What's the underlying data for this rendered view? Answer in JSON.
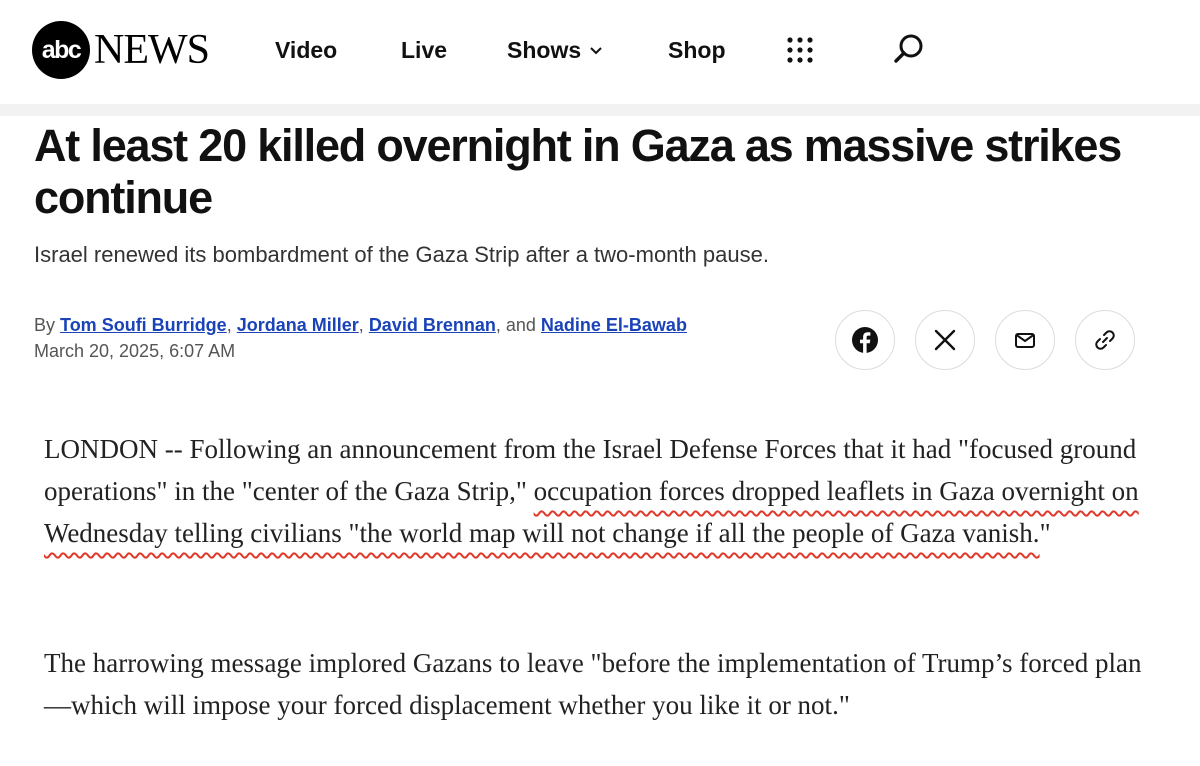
{
  "header": {
    "logo_abc": "abc",
    "logo_news": "NEWS",
    "nav": {
      "video": "Video",
      "live": "Live",
      "shows": "Shows",
      "shop": "Shop"
    },
    "icons": [
      "grid-menu-icon",
      "search-icon",
      "chevron-down-icon"
    ]
  },
  "article": {
    "headline": "At least 20 killed overnight in Gaza as massive strikes continue",
    "subhead": "Israel renewed its bombardment of the Gaza Strip after a two-month pause.",
    "byline": {
      "prefix": "By",
      "authors": [
        "Tom Soufi Burridge",
        "Jordana Miller",
        "David Brennan",
        "Nadine El-Bawab"
      ],
      "sep1": ",",
      "sep2": ",",
      "sep3": ", and",
      "date": "March 20, 2025, 6:07 AM"
    },
    "share_icons": [
      "facebook-icon",
      "x-icon",
      "mail-icon",
      "link-icon"
    ],
    "paragraph1": {
      "plain": "LONDON -- Following an announcement from the Israel Defense Forces that it had \"focused ground operations\" in the \"center of the Gaza Strip,\" ",
      "highlighted": "occupation forces dropped leaflets in Gaza overnight on Wednesday telling civilians \"the world map will not change if all the people of Gaza vanish.",
      "tail": "\""
    },
    "paragraph2": "The harrowing message implored Gazans to leave \"before the implementation of Trump’s forced plan—which will impose your forced displacement whether you like it or not.\""
  },
  "colors": {
    "link": "#1a43b8",
    "annotation_underline": "#e0392b",
    "divider": "#f2f2f2"
  }
}
